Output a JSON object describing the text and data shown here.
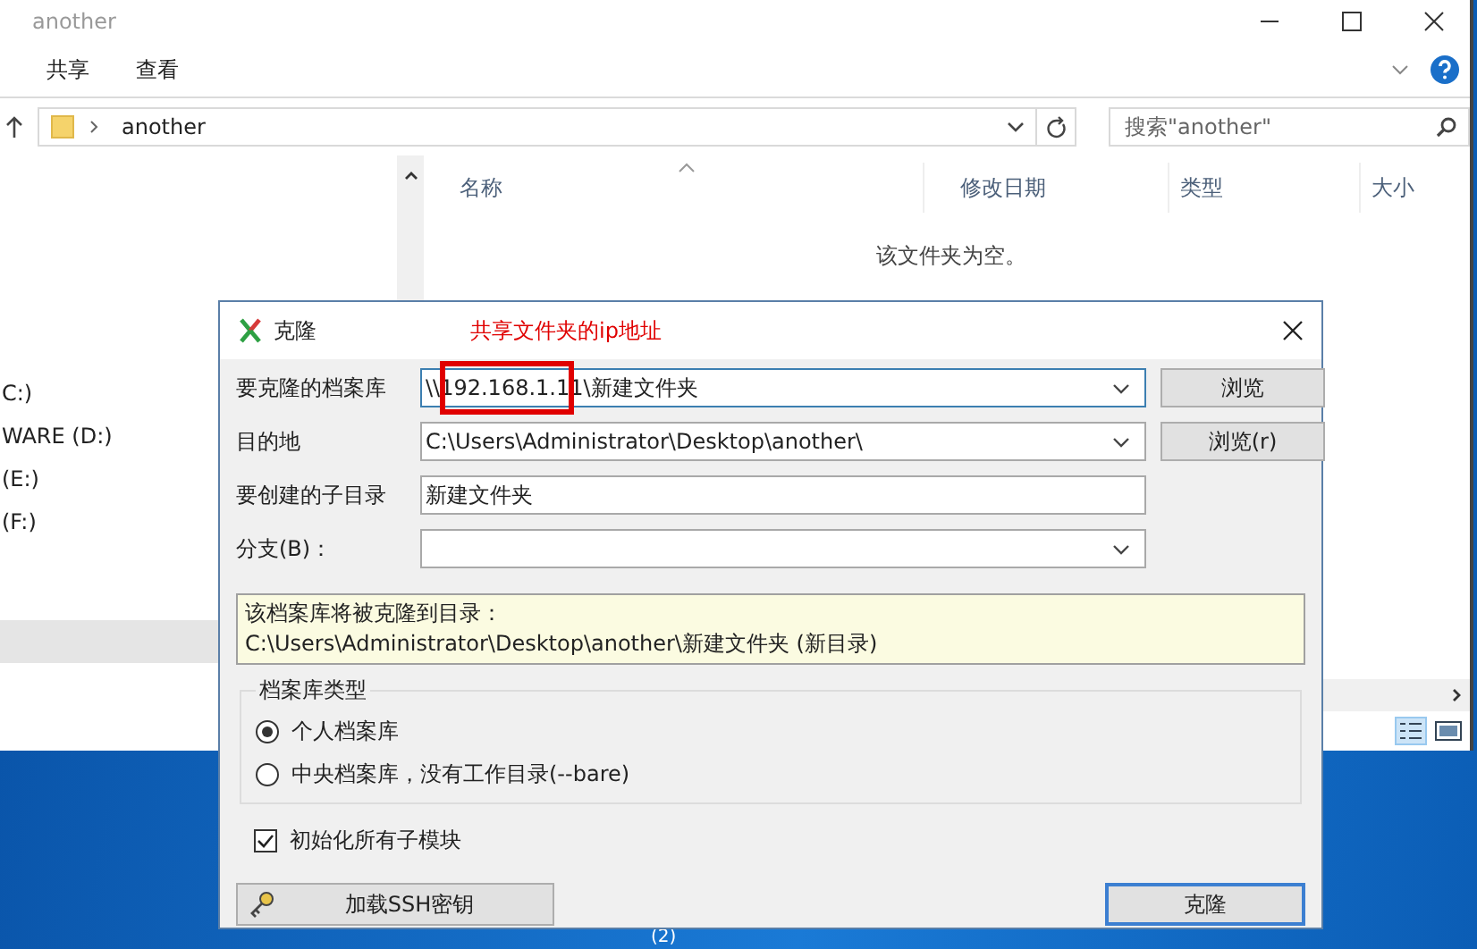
{
  "explorer": {
    "title": "another",
    "ribbon_tabs": [
      {
        "label": "共享"
      },
      {
        "label": "查看"
      }
    ],
    "address": {
      "path": "another"
    },
    "search": {
      "placeholder": "搜索\"another\""
    },
    "nav_items": [
      {
        "label": "C:)"
      },
      {
        "label": "WARE (D:)"
      },
      {
        "label": "(E:)"
      },
      {
        "label": "(F:)"
      }
    ],
    "columns": [
      "名称",
      "修改日期",
      "类型",
      "大小"
    ],
    "empty_message": "该文件夹为空。"
  },
  "desktop": {
    "icon_label": "(2)"
  },
  "dialog": {
    "title": "克隆",
    "annotation": "共享文件夹的ip地址",
    "fields": [
      {
        "label": "要克隆的档案库",
        "value": "\\\\192.168.1.11\\新建文件夹",
        "kind": "combo",
        "button": "浏览",
        "highlighted": true
      },
      {
        "label": "目的地",
        "value": "C:\\Users\\Administrator\\Desktop\\another\\",
        "kind": "combo",
        "button": "浏览(r)",
        "highlighted": false
      },
      {
        "label": "要创建的子目录",
        "value": "新建文件夹",
        "kind": "text",
        "highlighted": false
      },
      {
        "label": "分支(B)：",
        "kind": "combo",
        "highlighted": false
      }
    ],
    "info": [
      "该档案库将被克隆到目录：",
      "C:\\Users\\Administrator\\Desktop\\another\\新建文件夹 (新目录)"
    ],
    "repo_type": {
      "title": "档案库类型",
      "options": [
        {
          "label": "个人档案库",
          "selected": true
        },
        {
          "label": "中央档案库，没有工作目录(--bare)",
          "selected": false
        }
      ]
    },
    "init_submodules": {
      "label": "初始化所有子模块",
      "checked": true
    },
    "ssh_button": "加载SSH密钥",
    "ok_button": "克隆"
  }
}
